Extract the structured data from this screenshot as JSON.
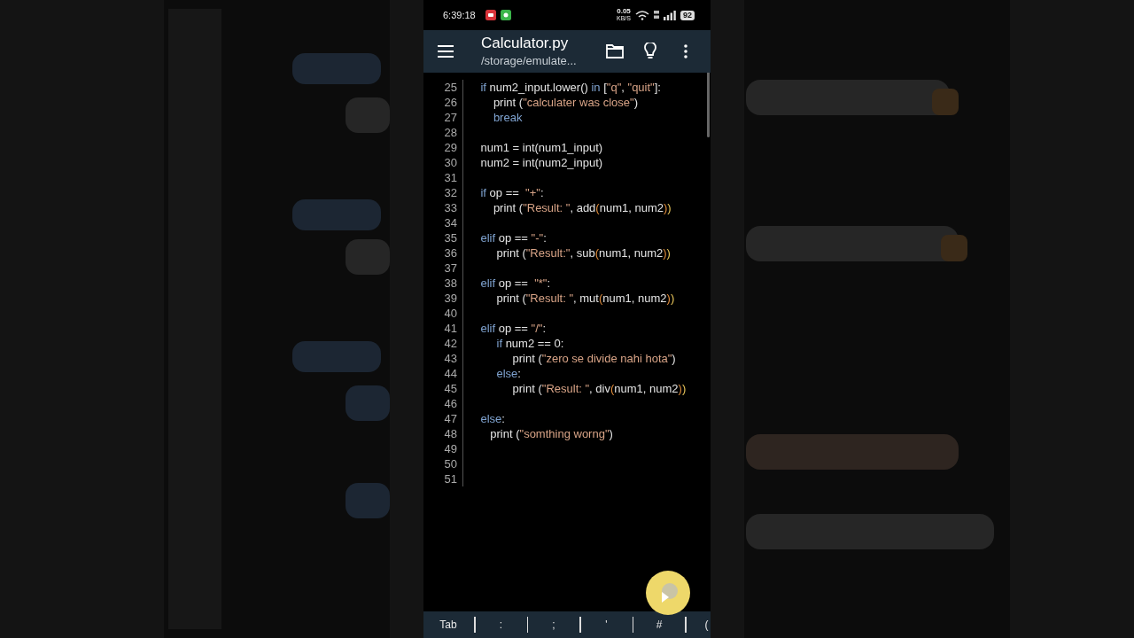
{
  "status_bar": {
    "time": "6:39:18",
    "net_speed": "0.05",
    "net_unit": "KB/S",
    "battery": "92"
  },
  "toolbar": {
    "title": "Calculator.py",
    "subtitle": "/storage/emulate..."
  },
  "editor": {
    "lines": [
      {
        "number": "25",
        "tokens": [
          {
            "kind": "kw",
            "text": "    if"
          },
          {
            "kind": "plain",
            "text": " num2_input.lower() "
          },
          {
            "kind": "kw",
            "text": "in"
          },
          {
            "kind": "plain",
            "text": " ["
          },
          {
            "kind": "str",
            "text": "\"q\""
          },
          {
            "kind": "plain",
            "text": ", "
          },
          {
            "kind": "str",
            "text": "\"quit\""
          },
          {
            "kind": "plain",
            "text": "]:"
          }
        ]
      },
      {
        "number": "26",
        "tokens": [
          {
            "kind": "plain",
            "text": "        print ("
          },
          {
            "kind": "str",
            "text": "\"calculater was close\""
          },
          {
            "kind": "plain",
            "text": ")"
          }
        ]
      },
      {
        "number": "27",
        "tokens": [
          {
            "kind": "kw",
            "text": "        break"
          }
        ]
      },
      {
        "number": "28"
      },
      {
        "number": "29",
        "tokens": [
          {
            "kind": "plain",
            "text": "    num1 = int(num1_input)"
          }
        ]
      },
      {
        "number": "30",
        "tokens": [
          {
            "kind": "plain",
            "text": "    num2 = int(num2_input)"
          }
        ]
      },
      {
        "number": "31"
      },
      {
        "number": "32",
        "tokens": [
          {
            "kind": "kw",
            "text": "    if"
          },
          {
            "kind": "plain",
            "text": " op ==  "
          },
          {
            "kind": "str",
            "text": "\"+\""
          },
          {
            "kind": "plain",
            "text": ":"
          }
        ]
      },
      {
        "number": "33",
        "tokens": [
          {
            "kind": "plain",
            "text": "        print ("
          },
          {
            "kind": "str",
            "text": "\"Result: \""
          },
          {
            "kind": "plain",
            "text": ", add"
          },
          {
            "kind": "paren",
            "text": "("
          },
          {
            "kind": "plain",
            "text": "num1, num2"
          },
          {
            "kind": "paren",
            "text": ")"
          },
          {
            "kind": "paren2",
            "text": ")"
          }
        ]
      },
      {
        "number": "34"
      },
      {
        "number": "35",
        "tokens": [
          {
            "kind": "kw",
            "text": "    elif"
          },
          {
            "kind": "plain",
            "text": " op == "
          },
          {
            "kind": "str",
            "text": "\"-\""
          },
          {
            "kind": "plain",
            "text": ":"
          }
        ]
      },
      {
        "number": "36",
        "tokens": [
          {
            "kind": "plain",
            "text": "         print ("
          },
          {
            "kind": "str",
            "text": "\"Result:\""
          },
          {
            "kind": "plain",
            "text": ", sub"
          },
          {
            "kind": "paren",
            "text": "("
          },
          {
            "kind": "plain",
            "text": "num1, num2"
          },
          {
            "kind": "paren",
            "text": ")"
          },
          {
            "kind": "paren2",
            "text": ")"
          }
        ]
      },
      {
        "number": "37"
      },
      {
        "number": "38",
        "tokens": [
          {
            "kind": "kw",
            "text": "    elif"
          },
          {
            "kind": "plain",
            "text": " op ==  "
          },
          {
            "kind": "str",
            "text": "\"*\""
          },
          {
            "kind": "plain",
            "text": ":"
          }
        ]
      },
      {
        "number": "39",
        "tokens": [
          {
            "kind": "plain",
            "text": "         print ("
          },
          {
            "kind": "str",
            "text": "\"Result: \""
          },
          {
            "kind": "plain",
            "text": ", mut"
          },
          {
            "kind": "paren",
            "text": "("
          },
          {
            "kind": "plain",
            "text": "num1, num2"
          },
          {
            "kind": "paren",
            "text": ")"
          },
          {
            "kind": "paren2",
            "text": ")"
          }
        ]
      },
      {
        "number": "40"
      },
      {
        "number": "41",
        "tokens": [
          {
            "kind": "kw",
            "text": "    elif"
          },
          {
            "kind": "plain",
            "text": " op == "
          },
          {
            "kind": "str",
            "text": "\"/\""
          },
          {
            "kind": "plain",
            "text": ":"
          }
        ]
      },
      {
        "number": "42",
        "tokens": [
          {
            "kind": "kw",
            "text": "         if"
          },
          {
            "kind": "plain",
            "text": " num2 == 0:"
          }
        ]
      },
      {
        "number": "43",
        "tokens": [
          {
            "kind": "plain",
            "text": "              print ("
          },
          {
            "kind": "str",
            "text": "\"zero se divide nahi hota\""
          },
          {
            "kind": "plain",
            "text": ")"
          }
        ]
      },
      {
        "number": "44",
        "tokens": [
          {
            "kind": "kw",
            "text": "         else"
          },
          {
            "kind": "plain",
            "text": ":"
          }
        ]
      },
      {
        "number": "45",
        "tokens": [
          {
            "kind": "plain",
            "text": "              print ("
          },
          {
            "kind": "str",
            "text": "\"Result: \""
          },
          {
            "kind": "plain",
            "text": ", div"
          },
          {
            "kind": "paren",
            "text": "("
          },
          {
            "kind": "plain",
            "text": "num1, num2"
          },
          {
            "kind": "paren",
            "text": ")"
          },
          {
            "kind": "paren2",
            "text": ")"
          }
        ]
      },
      {
        "number": "46"
      },
      {
        "number": "47",
        "tokens": [
          {
            "kind": "kw",
            "text": "    else"
          },
          {
            "kind": "plain",
            "text": ":"
          }
        ]
      },
      {
        "number": "48",
        "tokens": [
          {
            "kind": "plain",
            "text": "       print ("
          },
          {
            "kind": "str",
            "text": "\"somthing worng\""
          },
          {
            "kind": "plain",
            "text": ")"
          }
        ]
      },
      {
        "number": "49"
      },
      {
        "number": "50"
      },
      {
        "number": "51"
      }
    ]
  },
  "key_bar": {
    "keys": [
      "Tab",
      ":",
      ";",
      "'",
      "#",
      "("
    ]
  }
}
